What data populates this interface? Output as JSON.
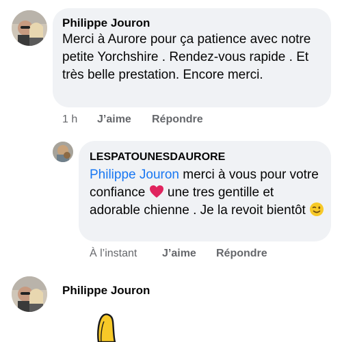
{
  "comments": [
    {
      "author": "Philippe Jouron",
      "text": "Merci à Aurore pour ça patience avec notre petite Yorchshire . Rendez-vous rapide . Et très belle prestation. Encore merci.",
      "time": "1 h",
      "like_label": "J’aime",
      "reply_label": "Répondre"
    }
  ],
  "reply": {
    "author": "LESPATOUNESDAURORE",
    "mention": "Philippe Jouron",
    "text_part1": " merci à vous pour votre confiance ",
    "text_part2": " une tres gentille et adorable chienne . Je la revoit bientôt ",
    "time": "À l’instant",
    "like_label": "J’aime",
    "reply_label": "Répondre"
  },
  "third_comment": {
    "author": "Philippe Jouron"
  },
  "icons": {
    "heart": "red-heart-icon",
    "wink": "winking-face-icon"
  },
  "colors": {
    "bubble_bg": "#f0f2f5",
    "mention": "#1877f2",
    "meta_text": "#65676b",
    "heart": "#e0245e",
    "emoji_yellow": "#f7c928"
  }
}
